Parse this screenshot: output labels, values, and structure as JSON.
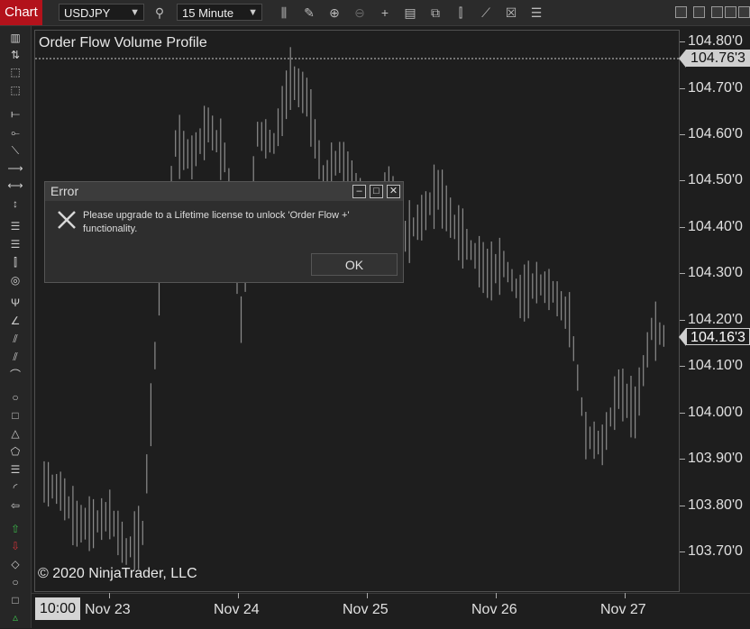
{
  "toolbar": {
    "chart_tab": "Chart",
    "instrument": "USDJPY",
    "interval": "15 Minute"
  },
  "chart": {
    "title": "Order Flow Volume Profile",
    "copyright": "© 2020 NinjaTrader, LLC",
    "price_high_tag": "104.76'3",
    "price_last_tag": "104.16'3",
    "time_box": "10:00"
  },
  "y_ticks": [
    "104.80'0",
    "104.70'0",
    "104.60'0",
    "104.50'0",
    "104.40'0",
    "104.30'0",
    "104.20'0",
    "104.10'0",
    "104.00'0",
    "103.90'0",
    "103.80'0",
    "103.70'0"
  ],
  "x_ticks": [
    "Nov 23",
    "Nov 24",
    "Nov 25",
    "Nov 26",
    "Nov 27"
  ],
  "dialog": {
    "title": "Error",
    "message": "Please upgrade to a Lifetime license to unlock 'Order Flow +' functionality.",
    "ok_label": "OK"
  },
  "chart_data": {
    "type": "line",
    "ylim": [
      103.66,
      104.83
    ],
    "x": [
      "Nov 23",
      "Nov 23",
      "Nov 23",
      "Nov 23",
      "Nov 23",
      "Nov 23",
      "Nov 24",
      "Nov 24",
      "Nov 24",
      "Nov 24",
      "Nov 24",
      "Nov 24",
      "Nov 24",
      "Nov 24",
      "Nov 24",
      "Nov 24",
      "Nov 24",
      "Nov 24",
      "Nov 25",
      "Nov 25",
      "Nov 25",
      "Nov 25",
      "Nov 25",
      "Nov 25",
      "Nov 25",
      "Nov 25",
      "Nov 26",
      "Nov 26",
      "Nov 26",
      "Nov 26",
      "Nov 26",
      "Nov 26",
      "Nov 26",
      "Nov 27",
      "Nov 27",
      "Nov 27",
      "Nov 27",
      "Nov 27",
      "Nov 27"
    ],
    "values": [
      103.85,
      103.83,
      103.76,
      103.76,
      103.78,
      103.7,
      103.74,
      104.25,
      104.58,
      104.55,
      104.62,
      104.55,
      104.2,
      104.6,
      104.58,
      104.72,
      104.68,
      104.5,
      104.55,
      104.45,
      104.42,
      104.5,
      104.38,
      104.42,
      104.48,
      104.4,
      104.35,
      104.3,
      104.32,
      104.25,
      104.28,
      104.26,
      104.2,
      103.95,
      103.93,
      104.05,
      104.0,
      104.18,
      104.16
    ],
    "last_price": 104.16,
    "high_marker": 104.76
  }
}
